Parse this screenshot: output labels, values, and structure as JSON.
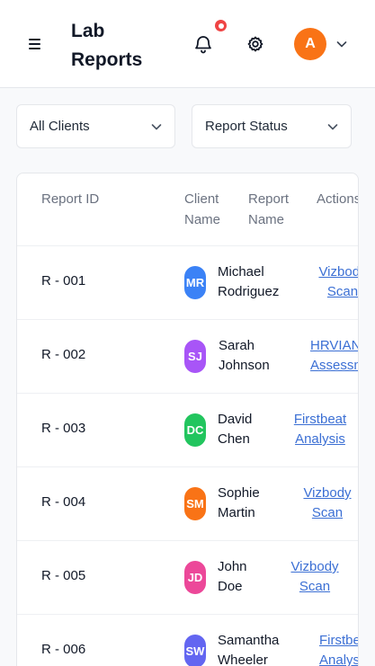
{
  "header": {
    "title": "Lab Reports",
    "avatar_initial": "A",
    "icons": [
      "menu-icon",
      "bell-icon",
      "gear-icon",
      "chevron-down-icon"
    ],
    "colors": {
      "avatar": "#f97316",
      "notification": "#ef4444",
      "link": "#3b6fd4"
    }
  },
  "filters": {
    "clients": "All Clients",
    "status": "Report Status"
  },
  "table": {
    "columns": {
      "report_id": "Report ID",
      "client_name": "Client Name",
      "report_name": "Report Name",
      "actions": "Actions"
    },
    "rows": [
      {
        "id": "R - 001",
        "initials": "MR",
        "client": "Michael Rodriguez",
        "report": "Vizbody Scan",
        "avatar_color": "#3b82f6"
      },
      {
        "id": "R - 002",
        "initials": "SJ",
        "client": "Sarah Johnson",
        "report": "HRVIANS Assessment",
        "avatar_color": "#a855f7"
      },
      {
        "id": "R - 003",
        "initials": "DC",
        "client": "David Chen",
        "report": "Firstbeat Analysis",
        "avatar_color": "#22c55e"
      },
      {
        "id": "R - 004",
        "initials": "SM",
        "client": "Sophie Martin",
        "report": "Vizbody Scan",
        "avatar_color": "#f97316"
      },
      {
        "id": "R - 005",
        "initials": "JD",
        "client": "John Doe",
        "report": "Vizbody Scan",
        "avatar_color": "#ec4899"
      },
      {
        "id": "R - 006",
        "initials": "SW",
        "client": "Samantha Wheeler",
        "report": "Firstbeat Analysis",
        "avatar_color": "#6366f1"
      }
    ]
  }
}
